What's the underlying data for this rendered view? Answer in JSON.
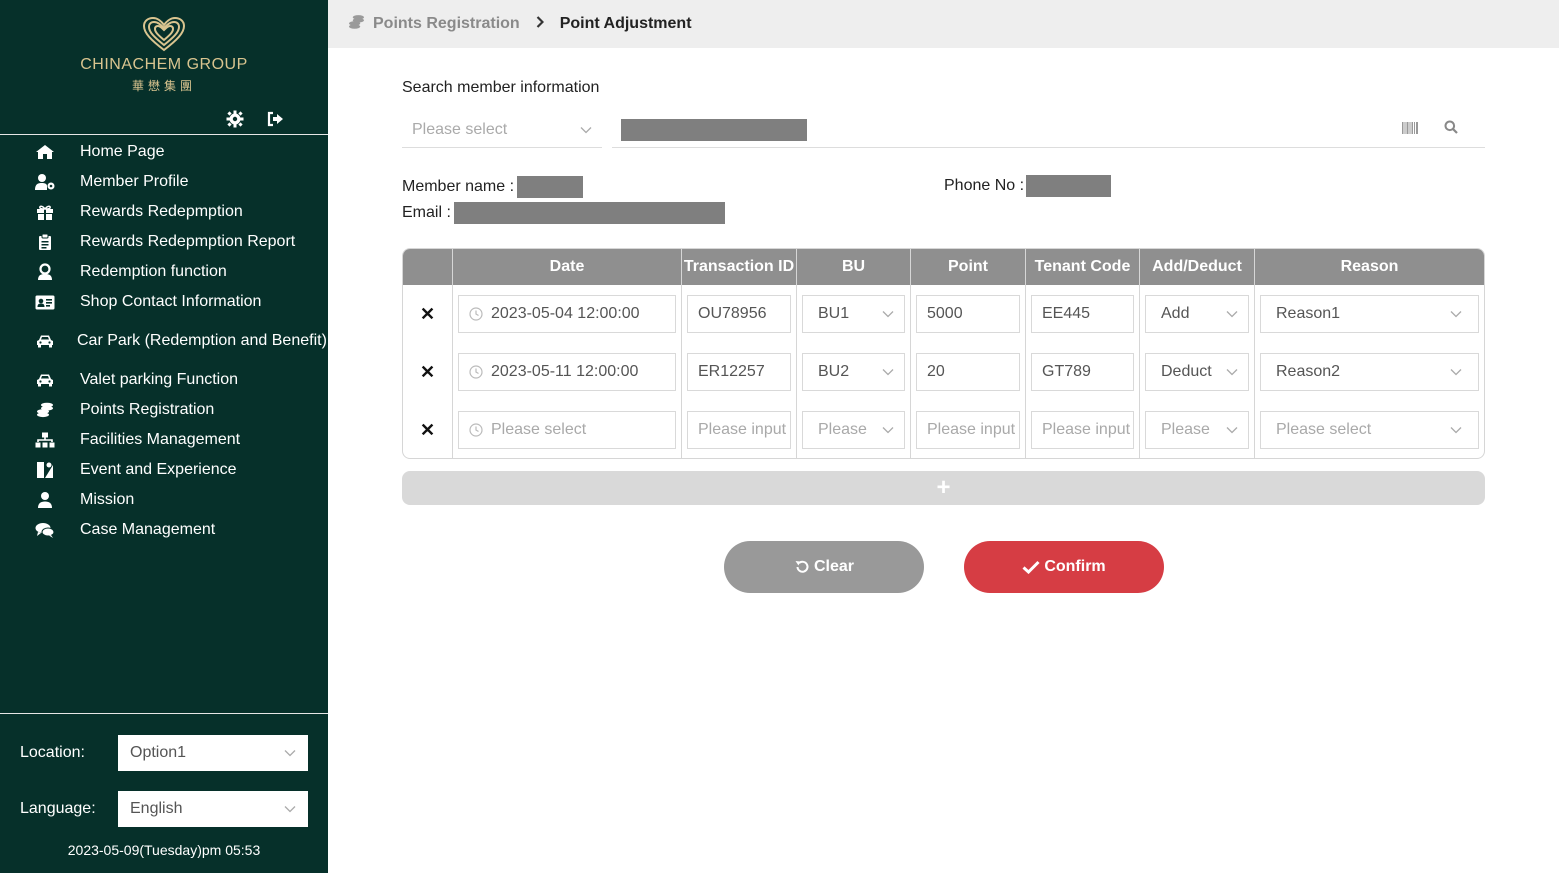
{
  "brand": {
    "name": "CHINACHEM GROUP",
    "name_cn": "華懋集團"
  },
  "sidebar": {
    "items": [
      {
        "label": "Home Page",
        "icon": "home-icon"
      },
      {
        "label": "Member Profile",
        "icon": "user-cog-icon"
      },
      {
        "label": "Rewards Redepmption",
        "icon": "gift-icon"
      },
      {
        "label": "Rewards Redepmption Report",
        "icon": "clipboard-icon"
      },
      {
        "label": "Redemption function",
        "icon": "user-badge-icon"
      },
      {
        "label": "Shop Contact Information",
        "icon": "contact-card-icon"
      },
      {
        "label": "Car Park (Redemption and Benefit)",
        "icon": "car-icon"
      },
      {
        "label": "Valet parking Function",
        "icon": "car-icon"
      },
      {
        "label": "Points Registration",
        "icon": "coins-icon"
      },
      {
        "label": "Facilities Management",
        "icon": "sitemap-icon"
      },
      {
        "label": "Event and Experience",
        "icon": "event-icon"
      },
      {
        "label": "Mission",
        "icon": "user-tie-icon"
      },
      {
        "label": "Case Management",
        "icon": "comments-icon"
      }
    ],
    "location_label": "Location:",
    "location_value": "Option1",
    "language_label": "Language:",
    "language_value": "English",
    "clock": "2023-05-09(Tuesday)pm 05:53"
  },
  "breadcrumb": {
    "parent": "Points Registration",
    "current": "Point Adjustment"
  },
  "search": {
    "title": "Search member information",
    "select_placeholder": "Please select"
  },
  "member": {
    "name_label": "Member name :",
    "phone_label": "Phone No :",
    "email_label": "Email :"
  },
  "table": {
    "headers": [
      "Date",
      "Transaction ID",
      "BU",
      "Point",
      "Tenant Code",
      "Add/Deduct",
      "Reason"
    ],
    "rows": [
      {
        "date": "2023-05-04 12:00:00",
        "txn": "OU78956",
        "bu": "BU1",
        "point": "5000",
        "tenant": "EE445",
        "adddeduct": "Add",
        "reason": "Reason1"
      },
      {
        "date": "2023-05-11 12:00:00",
        "txn": "ER12257",
        "bu": "BU2",
        "point": "20",
        "tenant": "GT789",
        "adddeduct": "Deduct",
        "reason": "Reason2"
      }
    ],
    "empty_row": {
      "date": "Please select",
      "txn": "Please input",
      "bu": "Please select",
      "point": "Please input",
      "tenant": "Please input",
      "adddeduct": "Please select",
      "reason": "Please select"
    }
  },
  "actions": {
    "add_symbol": "+",
    "clear": "Clear",
    "confirm": "Confirm"
  },
  "colors": {
    "sidebar_bg": "#06302a",
    "gold": "#d9c48f",
    "confirm": "#d63d44",
    "clear": "#999999",
    "header": "#8f8f8f"
  }
}
